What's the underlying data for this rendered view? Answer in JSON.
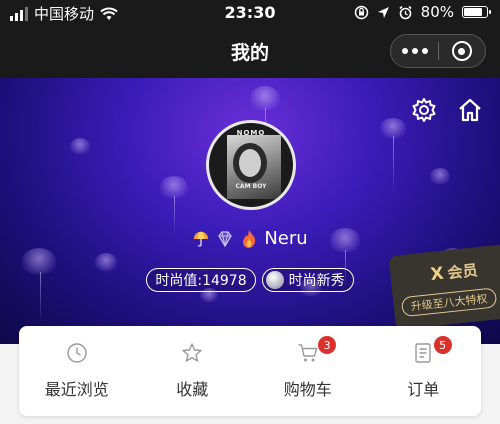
{
  "status_bar": {
    "carrier": "中国移动",
    "time": "23:30",
    "battery_percent": "80%",
    "battery_level": 0.8
  },
  "nav": {
    "title": "我的"
  },
  "profile": {
    "username": "Neru",
    "avatar_text_top": "NOMO",
    "avatar_text_bottom": "CAM BOY",
    "fashion_value_label": "时尚值:14978",
    "rank_label": "时尚新秀"
  },
  "vip": {
    "logo": "X",
    "title": "会员",
    "button": "升级至八大特权"
  },
  "menu": [
    {
      "label": "最近浏览",
      "icon": "clock-icon",
      "badge": ""
    },
    {
      "label": "收藏",
      "icon": "star-icon",
      "badge": ""
    },
    {
      "label": "购物车",
      "icon": "cart-icon",
      "badge": "3"
    },
    {
      "label": "订单",
      "icon": "order-icon",
      "badge": "5"
    }
  ],
  "colors": {
    "badge": "#d9322c",
    "vip_gold": "#e4c98f",
    "bar_bg": "#1a1a1a"
  }
}
